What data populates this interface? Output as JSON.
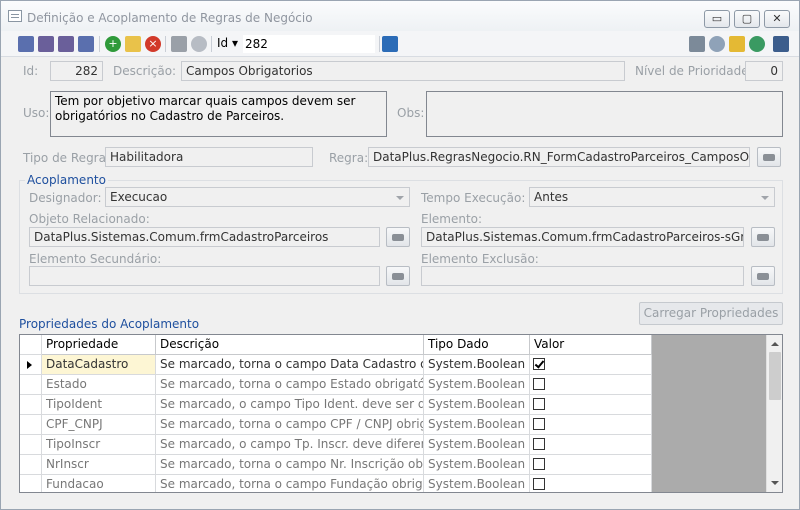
{
  "window": {
    "title": "Definição e Acoplamento de Regras de Negócio",
    "controls": {
      "minimize": "▭",
      "maximize": "▢",
      "close": "✕"
    }
  },
  "toolbar": {
    "id_label": "Id ▾",
    "id_value": "282",
    "icons": [
      "first-record-icon",
      "previous-record-icon",
      "next-record-icon",
      "last-record-icon",
      "add-icon",
      "edit-icon",
      "delete-icon",
      "save-icon",
      "undo-icon",
      "screen-icon",
      "cards-icon",
      "tools-icon",
      "clipboard-icon",
      "user-icon",
      "panel-icon"
    ]
  },
  "form": {
    "id_label": "Id:",
    "id_value": "282",
    "descricao_label": "Descrição:",
    "descricao_value": "Campos Obrigatorios",
    "prioridade_label": "Nível de Prioridade:",
    "prioridade_value": "0",
    "uso_label": "Uso:",
    "uso_value": "Tem por objetivo marcar quais campos devem ser obrigatórios no Cadastro de Parceiros.",
    "obs_label": "Obs:",
    "obs_value": "",
    "tipo_regra_label": "Tipo de Regra:",
    "tipo_regra_value": "Habilitadora",
    "regra_label": "Regra:",
    "regra_value": "DataPlus.RegrasNegocio.RN_FormCadastroParceiros_CamposObrigatorios"
  },
  "acoplamento": {
    "title": "Acoplamento",
    "designador_label": "Designador:",
    "designador_value": "Execucao",
    "tempo_label": "Tempo Execução:",
    "tempo_value": "Antes",
    "objeto_label": "Objeto Relacionado:",
    "objeto_value": "DataPlus.Sistemas.Comum.frmCadastroParceiros",
    "elemento_label": "Elemento:",
    "elemento_value": "DataPlus.Sistemas.Comum.frmCadastroParceiros-sGravar()",
    "secundario_label": "Elemento Secundário:",
    "secundario_value": "",
    "exclusao_label": "Elemento Exclusão:",
    "exclusao_value": ""
  },
  "propriedades": {
    "title": "Propriedades do Acoplamento",
    "load_button": "Carregar Propriedades",
    "columns": [
      "Propriedade",
      "Descrição",
      "Tipo Dado",
      "Valor"
    ],
    "rows": [
      {
        "propriedade": "DataCadastro",
        "descricao": "Se marcado, torna o campo Data Cadastro obrigatório.",
        "tipo": "System.Boolean",
        "valor": true
      },
      {
        "propriedade": "Estado",
        "descricao": "Se marcado, torna o campo Estado obrigatório.",
        "tipo": "System.Boolean",
        "valor": false
      },
      {
        "propriedade": "TipoIdent",
        "descricao": "Se marcado, o campo Tipo Ident. deve ser diferente de vazio.",
        "tipo": "System.Boolean",
        "valor": false
      },
      {
        "propriedade": "CPF_CNPJ",
        "descricao": "Se marcado, torna o campo CPF / CNPJ obrigatório.",
        "tipo": "System.Boolean",
        "valor": false
      },
      {
        "propriedade": "TipoInscr",
        "descricao": "Se marcado, o campo Tp. Inscr. deve diferente de vazio.",
        "tipo": "System.Boolean",
        "valor": false
      },
      {
        "propriedade": "NrInscr",
        "descricao": "Se marcado, torna o campo Nr. Inscrição obrigatório.",
        "tipo": "System.Boolean",
        "valor": false
      },
      {
        "propriedade": "Fundacao",
        "descricao": "Se marcado, torna o campo Fundação obrigatório.",
        "tipo": "System.Boolean",
        "valor": false
      }
    ]
  }
}
